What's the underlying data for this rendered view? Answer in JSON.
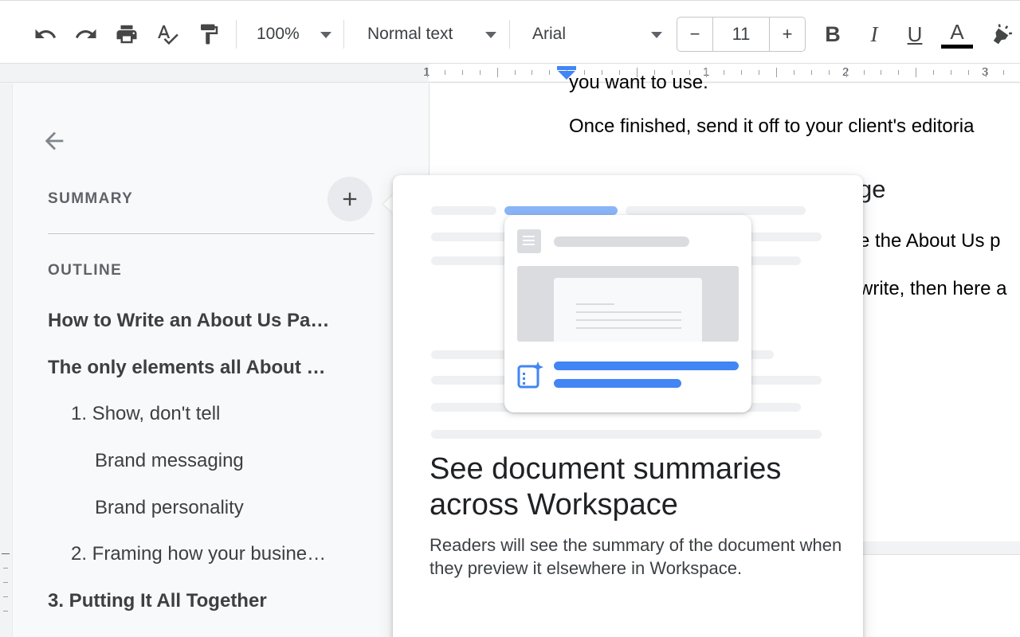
{
  "toolbar": {
    "undo_icon": "undo-icon",
    "redo_icon": "redo-icon",
    "print_icon": "print-icon",
    "spellcheck_icon": "spellcheck-icon",
    "paint_format_icon": "paint-format-icon",
    "zoom": "100%",
    "style": "Normal text",
    "font": "Arial",
    "decrease_size": "−",
    "font_size": "11",
    "increase_size": "+",
    "bold": "B",
    "italic": "I",
    "underline": "U",
    "text_color": "A",
    "highlight_icon": "highlight-icon"
  },
  "ruler": {
    "labels": [
      "1",
      "1",
      "2",
      "3"
    ]
  },
  "outline_panel": {
    "back_icon": "arrow-back-icon",
    "summary_label": "SUMMARY",
    "add_summary_icon": "plus-icon",
    "outline_label": "OUTLINE",
    "items": [
      {
        "text": "How to Write an About Us Pa…",
        "level": 1
      },
      {
        "text": "The only elements all About …",
        "level": 1
      },
      {
        "text": "1. Show, don't tell",
        "level": 2
      },
      {
        "text": "Brand messaging",
        "level": 3
      },
      {
        "text": "Brand personality",
        "level": 3
      },
      {
        "text": "2. Framing how your busine…",
        "level": 2
      },
      {
        "text": "3. Putting It All Together",
        "level": 1
      }
    ]
  },
  "document": {
    "line_cut": "you want to use.",
    "line1": "Once finished, send it off to your client's editoria",
    "heading_fragment": "ge",
    "line2": "e the About Us p",
    "line3": "write, then here a"
  },
  "popover": {
    "title": "See document summaries across Workspace",
    "body": "Readers will see the summary of the document when they preview it elsewhere in Workspace."
  },
  "colors": {
    "accent_blue": "#4285f4",
    "light_blue": "#8ab4f8",
    "gray_block": "#dadce0",
    "text_color_bar": "#000000"
  }
}
